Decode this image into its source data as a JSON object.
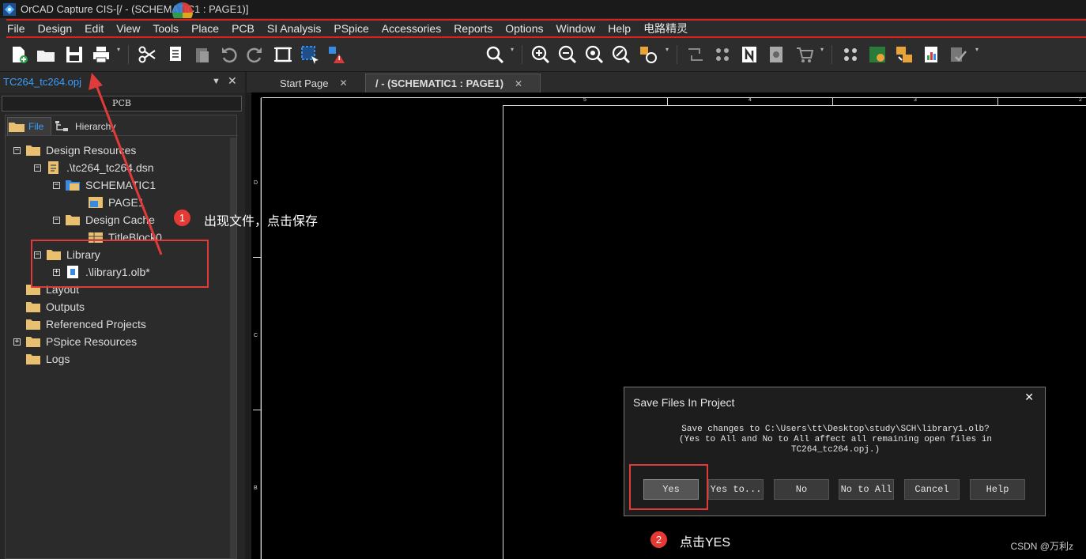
{
  "titlebar": {
    "title": "OrCAD Capture CIS-[/ - (SCHEMATIC1 : PAGE1)]"
  },
  "menu": [
    "File",
    "Design",
    "Edit",
    "View",
    "Tools",
    "Place",
    "PCB",
    "SI Analysis",
    "PSpice",
    "Accessories",
    "Reports",
    "Options",
    "Window",
    "Help",
    "电路精灵"
  ],
  "project_panel": {
    "project_name": "TC264_tc264.opj",
    "section_label": "PCB",
    "tabs": [
      "File",
      "Hierarchy"
    ],
    "tree": {
      "design_resources": "Design Resources",
      "dsn": ".\\tc264_tc264.dsn",
      "schematic": "SCHEMATIC1",
      "page": "PAGE1",
      "design_cache": "Design Cache",
      "titleblock": "TitleBlock0",
      "library": "Library",
      "library_file": ".\\library1.olb*",
      "layout": "Layout",
      "outputs": "Outputs",
      "referenced_projects": "Referenced Projects",
      "pspice_resources": "PSpice Resources",
      "logs": "Logs"
    }
  },
  "doc_tabs": [
    {
      "label": "Start Page",
      "active": false
    },
    {
      "label": "/ - (SCHEMATIC1 : PAGE1)",
      "active": true
    }
  ],
  "canvas": {
    "top_ruler": [
      "5",
      "4",
      "3",
      "2"
    ],
    "side_ruler": [
      "D",
      "C",
      "B"
    ]
  },
  "dialog": {
    "title": "Save Files In Project",
    "message_line1": "Save changes to C:\\Users\\tt\\Desktop\\study\\SCH\\library1.olb?",
    "message_line2": "(Yes to All and No to All affect all remaining open files in",
    "message_line3": "TC264_tc264.opj.)",
    "buttons": [
      "Yes",
      "Yes to...",
      "No",
      "No to All",
      "Cancel",
      "Help"
    ]
  },
  "annotations": {
    "step1_num": "1",
    "step1_text": "出现文件，点击保存",
    "step2_num": "2",
    "step2_text": "点击YES",
    "accent_color": "#e03a3a"
  },
  "watermark": "CSDN @万利z"
}
